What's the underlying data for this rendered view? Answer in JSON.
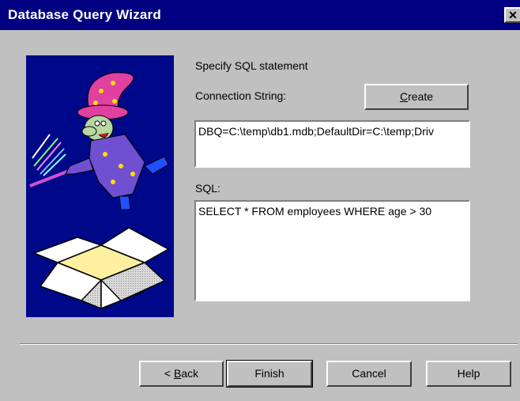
{
  "window": {
    "title": "Database Query Wizard",
    "close_glyph": "✕"
  },
  "content": {
    "heading": "Specify SQL statement",
    "connection_label": "Connection String:",
    "create_button": {
      "accel": "C",
      "rest": "reate"
    },
    "connection_value": "DBQ=C:\\temp\\db1.mdb;DefaultDir=C:\\temp;Driv",
    "sql_label": "SQL:",
    "sql_value": "SELECT * FROM employees WHERE age > 30"
  },
  "buttons": {
    "back": {
      "prefix": "< ",
      "accel": "B",
      "rest": "ack"
    },
    "finish": "Finish",
    "cancel": "Cancel",
    "help": "Help"
  },
  "image": {
    "icon": "wizard-with-open-box"
  }
}
